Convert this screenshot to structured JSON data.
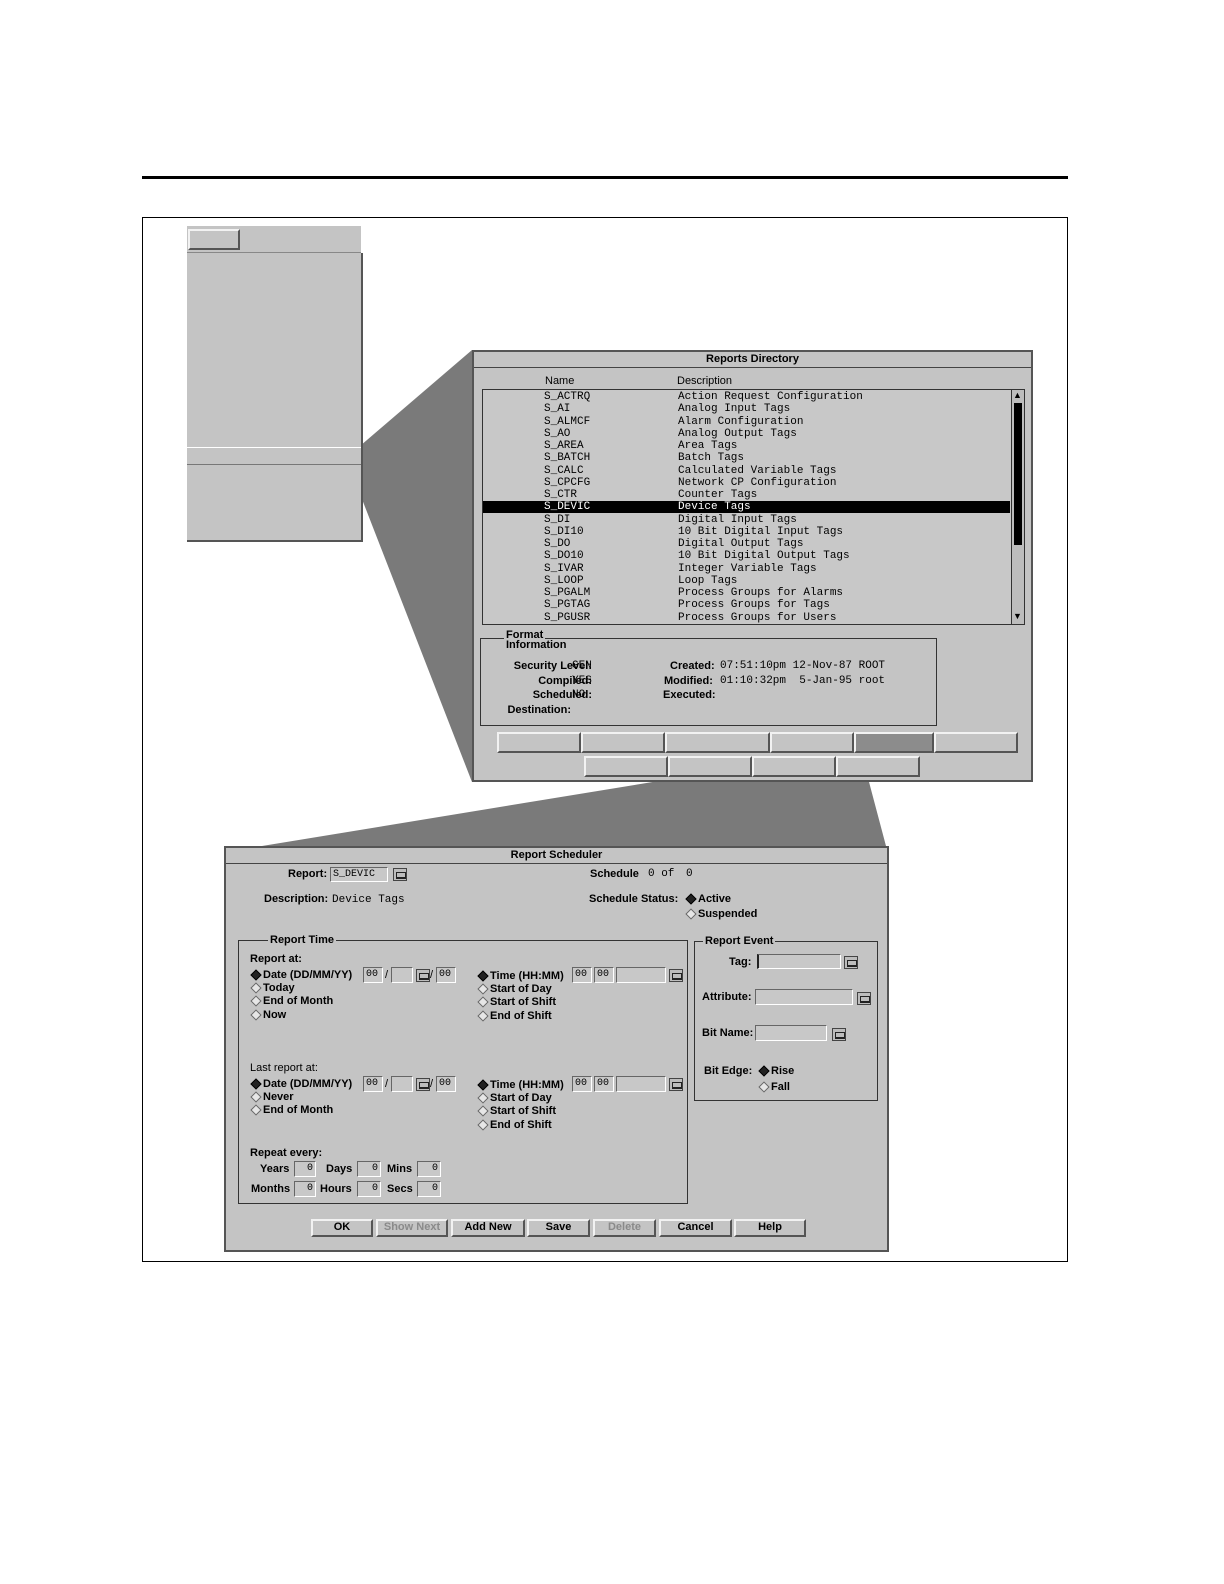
{
  "reports_directory": {
    "title": "Reports Directory",
    "col_name": "Name",
    "col_desc": "Description",
    "rows": [
      {
        "name": "S_ACTRQ",
        "desc": "Action Request Configuration"
      },
      {
        "name": "S_AI",
        "desc": "Analog Input Tags"
      },
      {
        "name": "S_ALMCF",
        "desc": "Alarm Configuration"
      },
      {
        "name": "S_AO",
        "desc": "Analog Output Tags"
      },
      {
        "name": "S_AREA",
        "desc": "Area Tags"
      },
      {
        "name": "S_BATCH",
        "desc": "Batch Tags"
      },
      {
        "name": "S_CALC",
        "desc": "Calculated Variable Tags"
      },
      {
        "name": "S_CPCFG",
        "desc": "Network CP Configuration"
      },
      {
        "name": "S_CTR",
        "desc": "Counter Tags"
      },
      {
        "name": "S_DEVIC",
        "desc": "Device Tags"
      },
      {
        "name": "S_DI",
        "desc": "Digital Input Tags"
      },
      {
        "name": "S_DI10",
        "desc": "10 Bit Digital Input Tags"
      },
      {
        "name": "S_DO",
        "desc": "Digital Output Tags"
      },
      {
        "name": "S_DO10",
        "desc": "10 Bit Digital Output Tags"
      },
      {
        "name": "S_IVAR",
        "desc": "Integer Variable Tags"
      },
      {
        "name": "S_LOOP",
        "desc": "Loop Tags"
      },
      {
        "name": "S_PGALM",
        "desc": "Process Groups for Alarms"
      },
      {
        "name": "S_PGTAG",
        "desc": "Process Groups for Tags"
      },
      {
        "name": "S_PGUSR",
        "desc": "Process Groups for Users"
      }
    ],
    "format_title_1": "Format",
    "format_title_2": "Information",
    "security_level_label": "Security Level:",
    "security_level": "GEN",
    "compiled_label": "Compiled:",
    "compiled": "YES",
    "scheduled_label": "Scheduled:",
    "scheduled": "NO",
    "destination_label": "Destination:",
    "created_label": "Created:",
    "created": "07:51:10pm 12-Nov-87 ROOT",
    "modified_label": "Modified:",
    "modified": "01:10:32pm  5-Jan-95 root",
    "executed_label": "Executed:"
  },
  "scheduler": {
    "title": "Report Scheduler",
    "report_label": "Report:",
    "report_value": "S_DEVIC",
    "schedule_label": "Schedule",
    "schedule_value": "0 of",
    "schedule_total": "0",
    "description_label": "Description:",
    "description_value": "Device Tags",
    "status_label": "Schedule Status:",
    "status_active": "Active",
    "status_suspended": "Suspended",
    "report_time_title": "Report Time",
    "report_at_label": "Report at:",
    "date_label": "Date (DD/MM/YY)",
    "today": "Today",
    "end_of_month": "End of Month",
    "now": "Now",
    "date_dd": "00",
    "date_slash": "/",
    "date_yy": "00",
    "time_label": "Time (HH:MM)",
    "time_hh": "00",
    "time_mm": "00",
    "start_of_day": "Start of Day",
    "start_of_shift": "Start of Shift",
    "end_of_shift": "End of Shift",
    "last_report_label": "Last report at:",
    "never": "Never",
    "repeat_label": "Repeat every:",
    "years": "Years",
    "years_v": "0",
    "days": "Days",
    "days_v": "0",
    "mins": "Mins",
    "mins_v": "0",
    "months": "Months",
    "months_v": "0",
    "hours": "Hours",
    "hours_v": "0",
    "secs": "Secs",
    "secs_v": "0",
    "report_event_title": "Report Event",
    "tag_label": "Tag:",
    "attribute_label": "Attribute:",
    "bit_name_label": "Bit Name:",
    "bit_edge_label": "Bit Edge:",
    "rise": "Rise",
    "fall": "Fall",
    "buttons": {
      "ok": "OK",
      "show_next": "Show Next",
      "add_new": "Add New",
      "save": "Save",
      "delete": "Delete",
      "cancel": "Cancel",
      "help": "Help"
    }
  }
}
